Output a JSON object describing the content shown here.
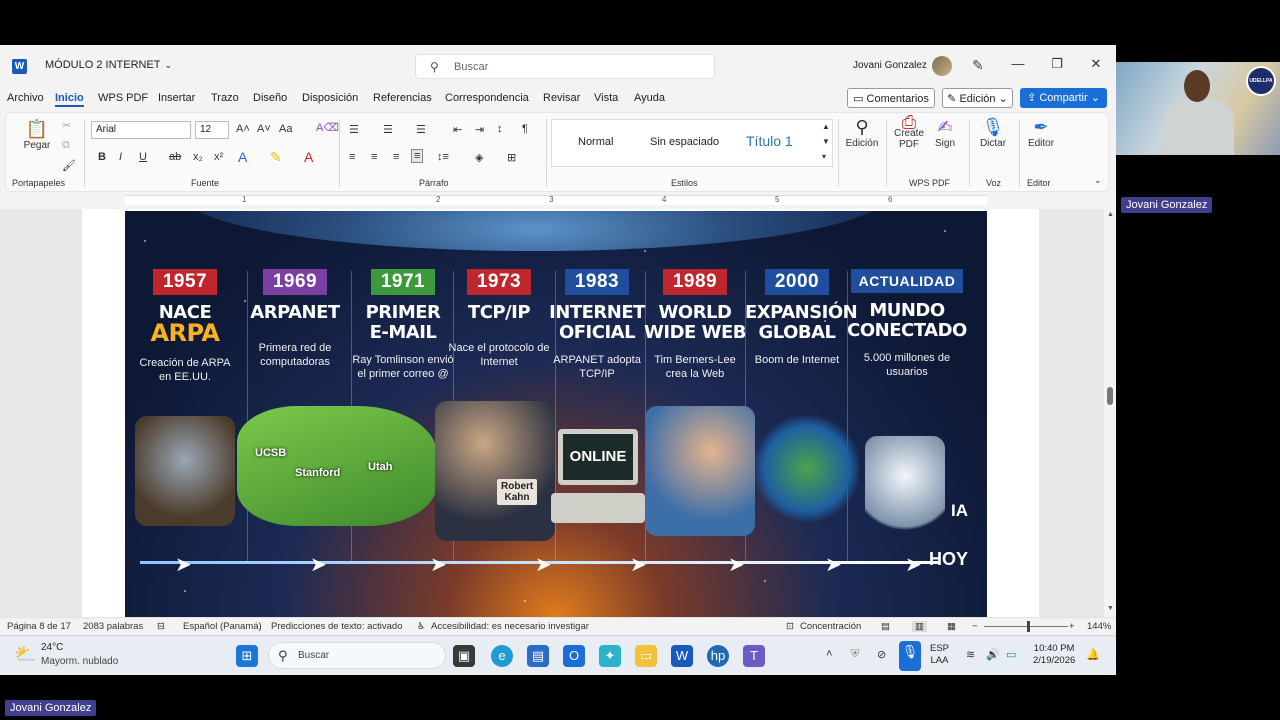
{
  "titlebar": {
    "doc_title": "MÓDULO 2 INTERNET",
    "search_placeholder": "Buscar",
    "user_name": "Jovani Gonzalez"
  },
  "menu": {
    "items": [
      "Archivo",
      "Inicio",
      "WPS PDF",
      "Insertar",
      "Trazo",
      "Diseño",
      "Disposición",
      "Referencias",
      "Correspondencia",
      "Revisar",
      "Vista",
      "Ayuda"
    ],
    "comentarios": "Comentarios",
    "edicion": "Edición",
    "compartir": "Compartir"
  },
  "ribbon": {
    "pegar": "Pegar",
    "portapapeles": "Portapapeles",
    "font_name": "Arial",
    "font_size": "12",
    "fuente": "Fuente",
    "parrafo": "Párrafo",
    "styles": [
      "Normal",
      "Sin espaciado",
      "Título 1"
    ],
    "estilos": "Estilos",
    "edicion": "Edición",
    "create_pdf": "Create PDF",
    "sign": "Sign",
    "wps_pdf": "WPS PDF",
    "dictar": "Dictar",
    "voz": "Voz",
    "editor": "Editor",
    "editor_group": "Editor"
  },
  "ruler_numbers": [
    "1",
    "2",
    "3",
    "4",
    "5",
    "6"
  ],
  "infographic": {
    "columns": [
      {
        "year": "1957",
        "title_a": "NACE",
        "title_b": "ARPA",
        "sub": "Creación de ARPA en EE.UU.",
        "color": "#c0262d"
      },
      {
        "year": "1969",
        "title_a": "ARPANET",
        "title_b": "",
        "sub": "Primera red de computadoras",
        "color": "#7a3fa0"
      },
      {
        "year": "1971",
        "title_a": "PRIMER",
        "title_b": "E-MAIL",
        "sub": "Ray Tomlinson envió el primer correo @",
        "color": "#3c9a3a"
      },
      {
        "year": "1973",
        "title_a": "TCP/IP",
        "title_b": "",
        "sub": "Nace el protocolo de Internet",
        "color": "#c0262d"
      },
      {
        "year": "1983",
        "title_a": "INTERNET",
        "title_b": "OFICIAL",
        "sub": "ARPANET adopta TCP/IP",
        "color": "#1f4f9c"
      },
      {
        "year": "1989",
        "title_a": "WORLD",
        "title_b": "WIDE WEB",
        "sub": "Tim Berners-Lee crea la Web",
        "color": "#c0262d"
      },
      {
        "year": "2000",
        "title_a": "EXPANSIÓN",
        "title_b": "GLOBAL",
        "sub": "Boom de Internet",
        "color": "#1f4f9c"
      },
      {
        "year": "ACTUALIDAD",
        "title_a": "MUNDO",
        "title_b": "CONECTADO",
        "sub": "5.000 millones de usuarios",
        "color": "#1f4f9c"
      }
    ],
    "map_labels": [
      "UCSB",
      "Stanford",
      "Utah"
    ],
    "tag_robert": "Robert Kahn",
    "online": "ONLINE",
    "ia": "IA",
    "hoy": "HOY"
  },
  "statusbar": {
    "page": "Página 8 de 17",
    "words": "2083 palabras",
    "language": "Español (Panamá)",
    "predictions": "Predicciones de texto: activado",
    "accessibility": "Accesibilidad: es necesario investigar",
    "focus": "Concentración",
    "zoom": "144%"
  },
  "taskbar": {
    "temp": "24°C",
    "weather": "Mayorm. nublado",
    "search": "Buscar",
    "lang_a": "ESP",
    "lang_b": "LAA",
    "time": "10:40 PM",
    "date": "2/19/2026"
  },
  "video": {
    "logo": "UDELLPA",
    "participant_top": "Jovani Gonzalez",
    "participant_bottom": "Jovani Gonzalez"
  }
}
